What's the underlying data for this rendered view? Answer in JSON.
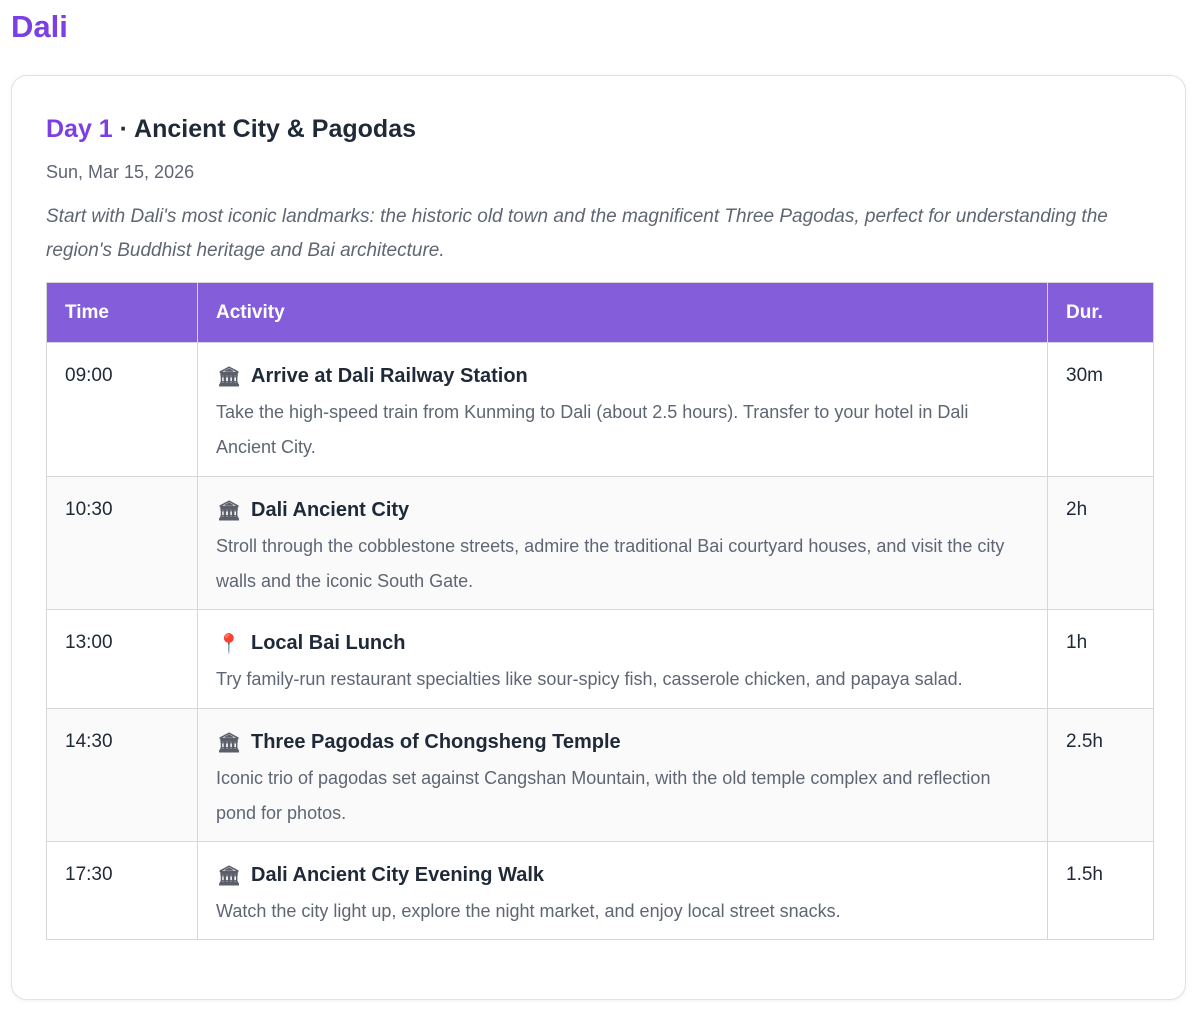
{
  "page": {
    "title": "Dali"
  },
  "day": {
    "number_label": "Day 1",
    "separator": " · ",
    "title": "Ancient City & Pagodas",
    "date": "Sun, Mar 15, 2026",
    "intro": "Start with Dali's most iconic landmarks: the historic old town and the magnificent Three Pagodas, perfect for understanding the region's Buddhist heritage and Bai architecture."
  },
  "table": {
    "headers": {
      "time": "Time",
      "activity": "Activity",
      "duration": "Dur."
    },
    "rows": [
      {
        "time": "09:00",
        "icon": "landmark-icon",
        "icon_glyph": "🏛",
        "title": "Arrive at Dali Railway Station",
        "description": "Take the high-speed train from Kunming to Dali (about 2.5 hours). Transfer to your hotel in Dali Ancient City.",
        "duration": "30m"
      },
      {
        "time": "10:30",
        "icon": "landmark-icon",
        "icon_glyph": "🏛",
        "title": "Dali Ancient City",
        "description": "Stroll through the cobblestone streets, admire the traditional Bai courtyard houses, and visit the city walls and the iconic South Gate.",
        "duration": "2h"
      },
      {
        "time": "13:00",
        "icon": "map-pin-icon",
        "icon_glyph": "📍",
        "title": "Local Bai Lunch",
        "description": "Try family-run restaurant specialties like sour-spicy fish, casserole chicken, and papaya salad.",
        "duration": "1h"
      },
      {
        "time": "14:30",
        "icon": "landmark-icon",
        "icon_glyph": "🏛",
        "title": "Three Pagodas of Chongsheng Temple",
        "description": "Iconic trio of pagodas set against Cangshan Mountain, with the old temple complex and reflection pond for photos.",
        "duration": "2.5h"
      },
      {
        "time": "17:30",
        "icon": "landmark-icon",
        "icon_glyph": "🏛",
        "title": "Dali Ancient City Evening Walk",
        "description": "Watch the city light up, explore the night market, and enjoy local street snacks.",
        "duration": "1.5h"
      }
    ]
  },
  "colors": {
    "accent": "#7b3fe4",
    "header_bg": "#845ddb",
    "muted_text": "#5f6673",
    "border": "#d6d6db"
  }
}
